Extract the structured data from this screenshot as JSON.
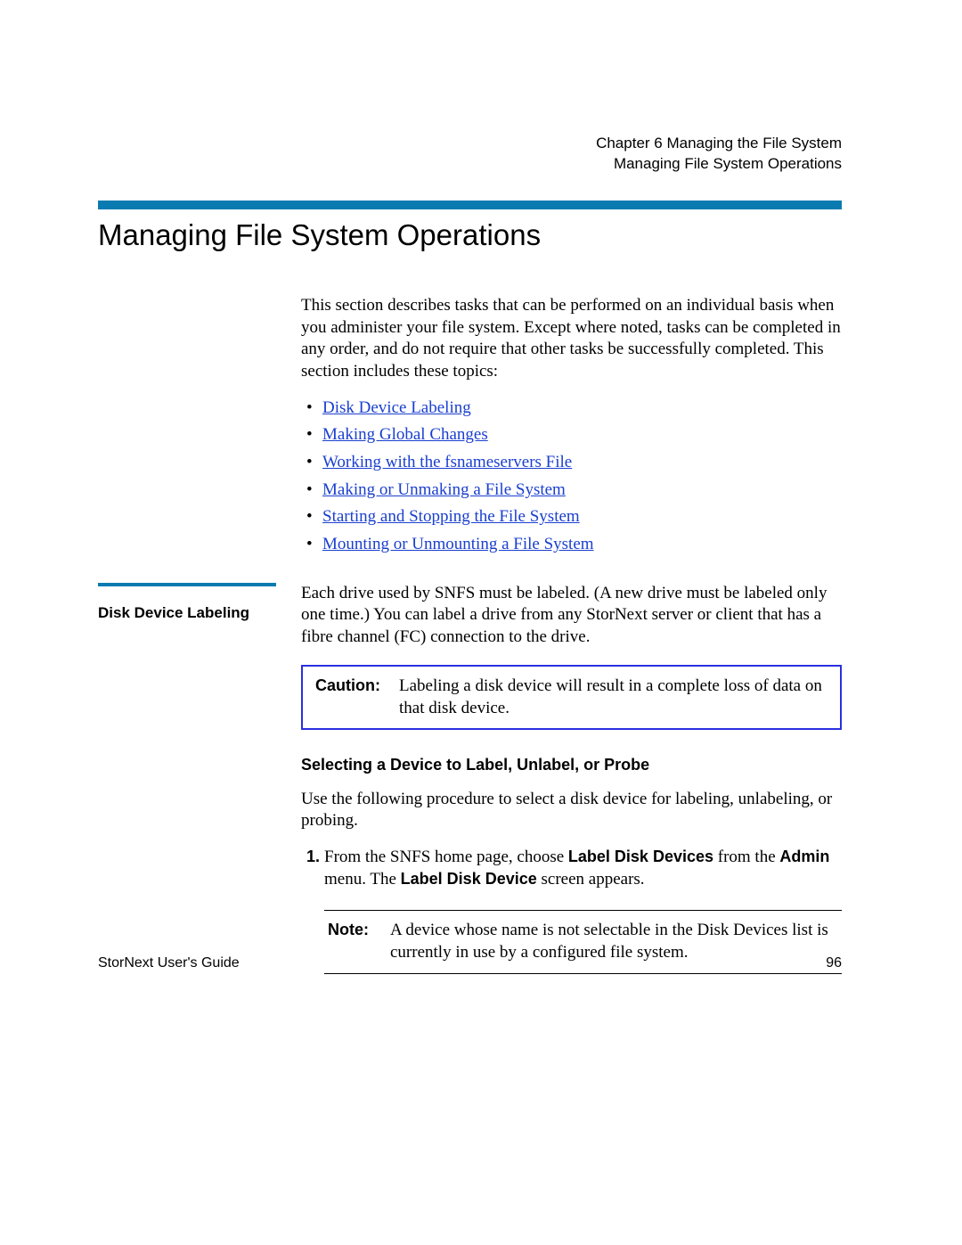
{
  "running_head": {
    "chapter": "Chapter 6  Managing the File System",
    "section": "Managing File System Operations"
  },
  "h1": "Managing File System Operations",
  "intro": "This section describes tasks that can be performed on an individual basis when you administer your file system. Except where noted, tasks can be completed in any order, and do not require that other tasks be successfully completed. This section includes these topics:",
  "topics": [
    "Disk Device Labeling",
    "Making Global Changes",
    "Working with the fsnameservers File",
    "Making or Unmaking a File System",
    "Starting and Stopping the File System",
    "Mounting or Unmounting a File System"
  ],
  "side_label": "Disk Device Labeling",
  "ddl_para": "Each drive used by SNFS must be labeled. (A new drive must be labeled only one time.) You can label a drive from any StorNext server or client that has a fibre channel (FC) connection to the drive.",
  "caution": {
    "label": "Caution:",
    "text": "Labeling a disk device will result in a complete loss of data on that disk device."
  },
  "subhead": "Selecting a Device to Label, Unlabel, or Probe",
  "sel_para": "Use the following procedure to select a disk device for labeling, unlabeling, or probing.",
  "step1": {
    "pre": "From the SNFS home page, choose ",
    "b1": "Label Disk Devices",
    "mid": " from the ",
    "b2": "Admin",
    "mid2": " menu. The ",
    "b3": "Label Disk Device",
    "post": " screen appears."
  },
  "note": {
    "label": "Note:",
    "text": "A device whose name is not selectable in the Disk Devices list is currently in use by a configured file system."
  },
  "footer": {
    "left": "StorNext User's Guide",
    "right": "96"
  }
}
